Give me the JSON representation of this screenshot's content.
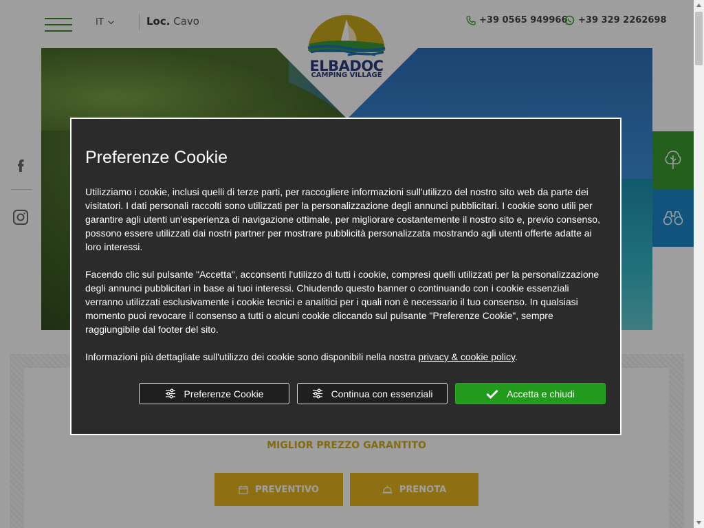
{
  "header": {
    "menu_icon": "hamburger-icon",
    "language": "IT",
    "location_prefix": "Loc.",
    "location_name": "Cavo",
    "phone": "+39 0565 949966",
    "whatsapp": "+39 329 2262698"
  },
  "logo": {
    "title": "ELBADOC",
    "subtitle": "CAMPING VILLAGE",
    "colors": {
      "sun": "#c9a81a",
      "sea": "#1e74b8",
      "land": "#3a9a3a",
      "text": "#2d3a7c"
    }
  },
  "social": [
    {
      "name": "facebook-icon"
    },
    {
      "name": "instagram-icon"
    }
  ],
  "side_buttons": [
    {
      "icon": "tree-icon",
      "color": "#3a9a30"
    },
    {
      "icon": "binoculars-icon",
      "color": "#1a86c8"
    }
  ],
  "booking": {
    "guarantee": "MIGLIOR PREZZO GARANTITO",
    "quote_button": "PREVENTIVO",
    "book_button": "PRENOTA",
    "accent": "#e6b51e"
  },
  "cookie_modal": {
    "title": "Preferenze Cookie",
    "paragraph1": "Utilizziamo i cookie, inclusi quelli di terze parti, per raccogliere informazioni sull'utilizzo del nostro sito web da parte dei visitatori. I dati personali raccolti sono utilizzati per la personalizzazione degli annunci pubblicitari. I cookie sono utili per garantire agli utenti un'esperienza di navigazione ottimale, per migliorare costantemente il nostro sito e, previo consenso, possono essere utilizzati dai nostri partner per mostrare pubblicità personalizzata mostrando agli utenti offerte adatte ai loro interessi.",
    "paragraph2": "Facendo clic sul pulsante \"Accetta\", acconsenti l'utilizzo di tutti i cookie, compresi quelli utilizzati per la personalizzazione degli annunci pubblicitari in base ai tuoi interessi. Chiudendo questo banner o continuando con i cookie essenziali verranno utilizzati esclusivamente i cookie tecnici e analitici per i quali non è necessario il tuo consenso. In qualsiasi momento puoi revocare il consenso a tutti o alcuni cookie cliccando sul pulsante \"Preferenze Cookie\", sempre raggiungibile dal footer del sito.",
    "paragraph3_prefix": "Informazioni più dettagliate sull'utilizzo dei cookie sono disponibili nella nostra ",
    "policy_link": "privacy & cookie policy",
    "paragraph3_suffix": ".",
    "btn_preferences": "Preferenze Cookie",
    "btn_essentials": "Continua con essenziali",
    "btn_accept": "Accetta e chiudi",
    "accept_color": "#229a1c"
  }
}
